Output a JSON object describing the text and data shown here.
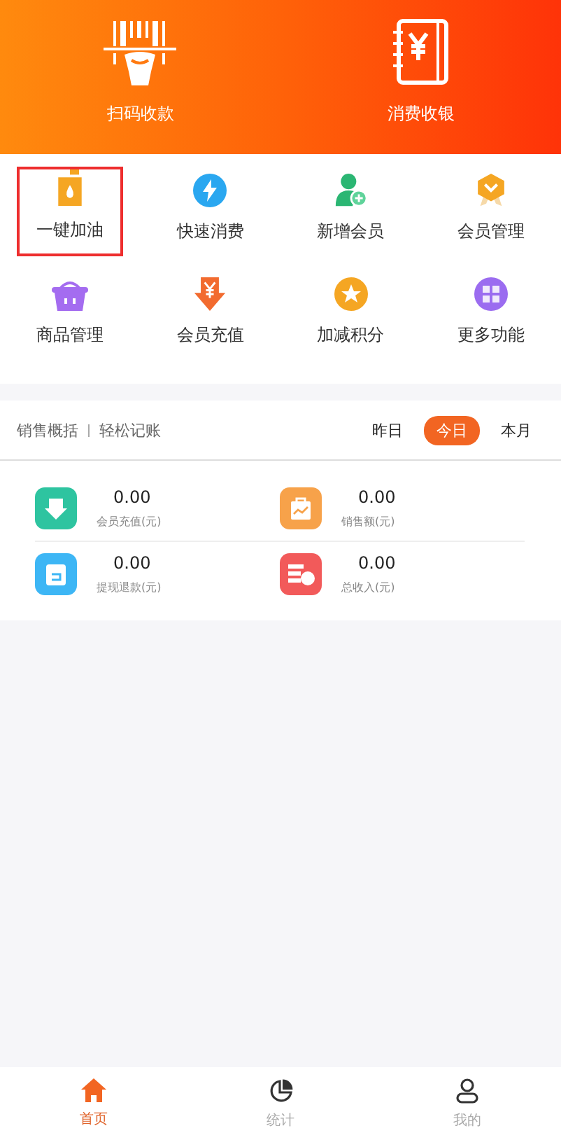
{
  "header_actions": [
    {
      "kind": "scan",
      "label": "扫码收款"
    },
    {
      "kind": "ledger",
      "label": "消费收银"
    }
  ],
  "features": [
    {
      "kind": "fuel",
      "label": "一键加油",
      "highlighted": true
    },
    {
      "kind": "bolt",
      "label": "快速消费",
      "highlighted": false
    },
    {
      "kind": "add-member",
      "label": "新增会员",
      "highlighted": false
    },
    {
      "kind": "badge",
      "label": "会员管理",
      "highlighted": false
    },
    {
      "kind": "basket",
      "label": "商品管理",
      "highlighted": false
    },
    {
      "kind": "recharge",
      "label": "会员充值",
      "highlighted": false
    },
    {
      "kind": "star",
      "label": "加减积分",
      "highlighted": false
    },
    {
      "kind": "more",
      "label": "更多功能",
      "highlighted": false
    }
  ],
  "sales": {
    "title": "销售概括",
    "subtitle": "轻松记账",
    "periods": [
      {
        "label": "昨日",
        "selected": false
      },
      {
        "label": "今日",
        "selected": true
      },
      {
        "label": "本月",
        "selected": false
      }
    ],
    "stats": [
      {
        "kind": "recharge",
        "value": "0.00",
        "label": "会员充值(元)"
      },
      {
        "kind": "sales",
        "value": "0.00",
        "label": "销售额(元)"
      },
      {
        "kind": "refund",
        "value": "0.00",
        "label": "提现退款(元)"
      },
      {
        "kind": "income",
        "value": "0.00",
        "label": "总收入(元)"
      }
    ]
  },
  "tab_bar": [
    {
      "kind": "home",
      "label": "首页",
      "selected": true
    },
    {
      "kind": "stats",
      "label": "统计",
      "selected": false
    },
    {
      "kind": "profile",
      "label": "我的",
      "selected": false
    }
  ]
}
